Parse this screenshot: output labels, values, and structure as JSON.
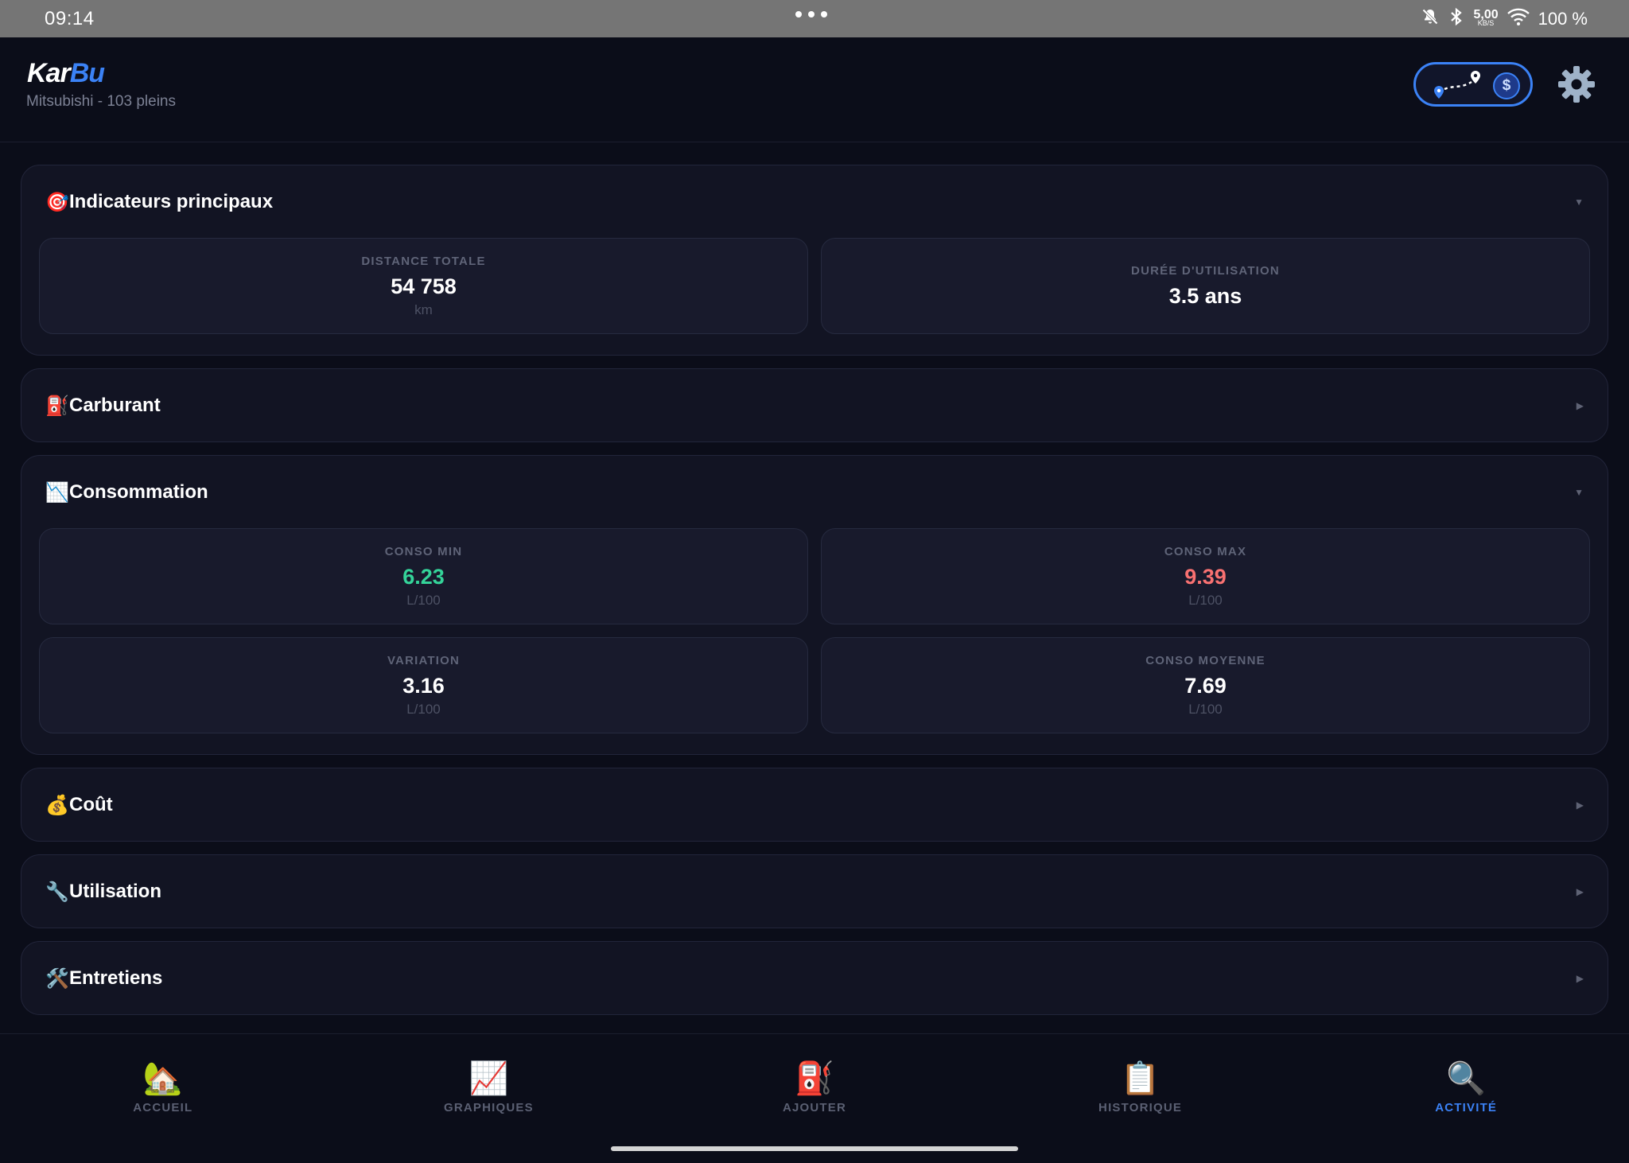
{
  "status_bar": {
    "time": "09:14",
    "net_speed_value": "5,00",
    "net_speed_unit": "KB/S",
    "battery": "100 %",
    "icons": [
      "bell-off-icon",
      "bluetooth-icon",
      "wifi-icon"
    ]
  },
  "header": {
    "logo_part1": "Kar",
    "logo_part2": "Bu",
    "subtitle": "Mitsubishi - 103 pleins",
    "mode_toggle_icons": [
      "route-icon",
      "dollar-coin-icon"
    ],
    "coin_symbol": "$",
    "settings_icon": "gear-icon"
  },
  "sections": [
    {
      "title": "Indicateurs principaux",
      "emoji": "🎯",
      "expanded": true,
      "chevron": "▼",
      "cards": [
        {
          "label": "DISTANCE TOTALE",
          "value": "54 758",
          "unit": "km"
        },
        {
          "label": "DURÉE D'UTILISATION",
          "value": "3.5 ans",
          "unit": ""
        }
      ]
    },
    {
      "title": "Carburant",
      "emoji": "⛽",
      "expanded": false,
      "chevron": "▶"
    },
    {
      "title": "Consommation",
      "emoji": "📉",
      "expanded": true,
      "chevron": "▼",
      "cards": [
        {
          "label": "CONSO MIN",
          "value": "6.23",
          "unit": "L/100"
        },
        {
          "label": "CONSO MAX",
          "value": "9.39",
          "unit": "L/100"
        },
        {
          "label": "VARIATION",
          "value": "3.16",
          "unit": "L/100"
        },
        {
          "label": "CONSO MOYENNE",
          "value": "7.69",
          "unit": "L/100"
        }
      ]
    },
    {
      "title": "Coût",
      "emoji": "💰",
      "expanded": false,
      "chevron": "▶"
    },
    {
      "title": "Utilisation",
      "emoji": "🔧",
      "expanded": false,
      "chevron": "▶"
    },
    {
      "title": "Entretiens",
      "emoji": "🛠️",
      "expanded": false,
      "chevron": "▶"
    }
  ],
  "colors": {
    "accent": "#3b82f6",
    "good": "#34d399",
    "bad": "#f87171"
  },
  "bottom_nav": [
    {
      "label": "ACCUEIL",
      "icon": "🏡",
      "active": false
    },
    {
      "label": "GRAPHIQUES",
      "icon": "📈",
      "active": false
    },
    {
      "label": "AJOUTER",
      "icon": "⛽",
      "active": false
    },
    {
      "label": "HISTORIQUE",
      "icon": "📋",
      "active": false
    },
    {
      "label": "ACTIVITÉ",
      "icon": "🔍",
      "active": true
    }
  ]
}
